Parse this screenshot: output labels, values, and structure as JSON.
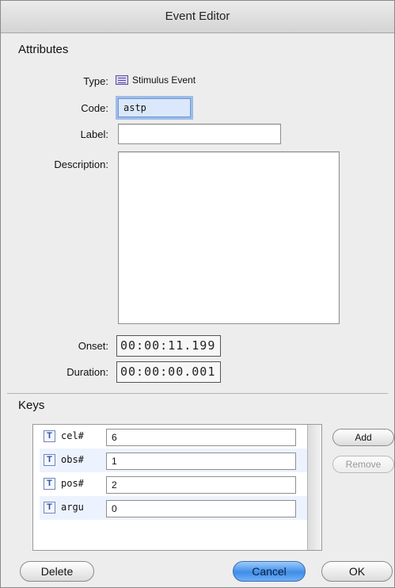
{
  "window": {
    "title": "Event Editor"
  },
  "attributes": {
    "section_title": "Attributes",
    "type_label": "Type:",
    "type_value": "Stimulus Event",
    "type_icon": "stimulus-event-icon",
    "code_label": "Code:",
    "code_value": "astp",
    "label_label": "Label:",
    "label_value": "",
    "description_label": "Description:",
    "description_value": "",
    "onset_label": "Onset:",
    "onset_value": "00:00:11.199",
    "duration_label": "Duration:",
    "duration_value": "00:00:00.001"
  },
  "keys": {
    "section_title": "Keys",
    "type_glyph": "T",
    "rows": [
      {
        "name": "cel#",
        "value": "6"
      },
      {
        "name": "obs#",
        "value": "1"
      },
      {
        "name": "pos#",
        "value": "2"
      },
      {
        "name": "argu",
        "value": "0"
      }
    ],
    "add_label": "Add",
    "remove_label": "Remove"
  },
  "footer": {
    "delete_label": "Delete",
    "cancel_label": "Cancel",
    "ok_label": "OK"
  },
  "colors": {
    "window_bg": "#ededed",
    "focus_ring": "#5c94e6",
    "primary_button": "#3f8ee8",
    "alt_row": "#edf3fe"
  }
}
